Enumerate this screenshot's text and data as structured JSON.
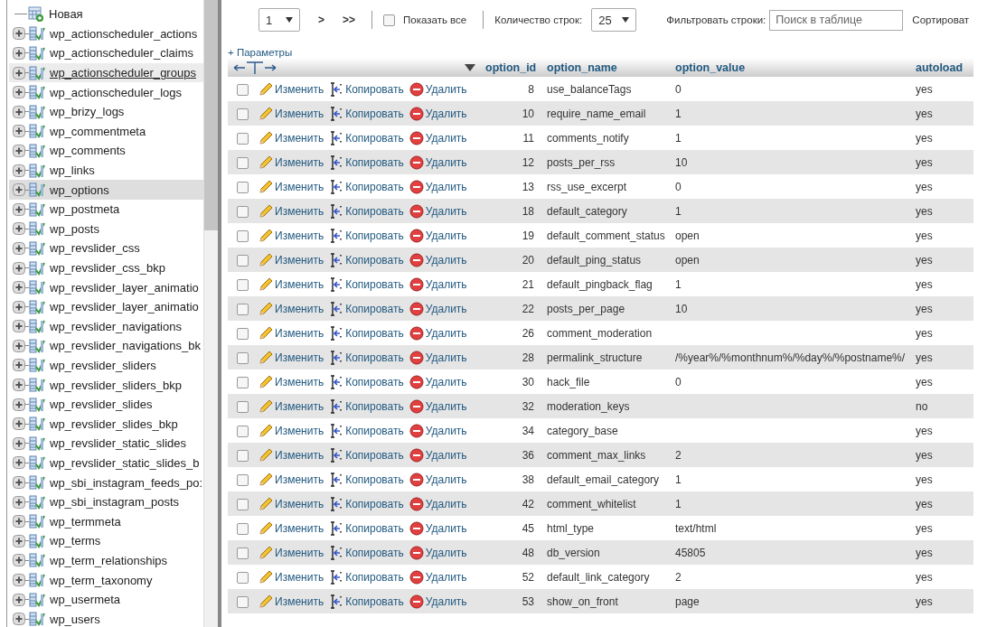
{
  "sidebar": {
    "new_item": "Новая",
    "items": [
      {
        "label": "wp_actionscheduler_actions",
        "selected": false,
        "hovered": false
      },
      {
        "label": "wp_actionscheduler_claims",
        "selected": false,
        "hovered": false
      },
      {
        "label": "wp_actionscheduler_groups",
        "selected": false,
        "hovered": true
      },
      {
        "label": "wp_actionscheduler_logs",
        "selected": false,
        "hovered": false
      },
      {
        "label": "wp_brizy_logs",
        "selected": false,
        "hovered": false
      },
      {
        "label": "wp_commentmeta",
        "selected": false,
        "hovered": false
      },
      {
        "label": "wp_comments",
        "selected": false,
        "hovered": false
      },
      {
        "label": "wp_links",
        "selected": false,
        "hovered": false
      },
      {
        "label": "wp_options",
        "selected": true,
        "hovered": false
      },
      {
        "label": "wp_postmeta",
        "selected": false,
        "hovered": false
      },
      {
        "label": "wp_posts",
        "selected": false,
        "hovered": false
      },
      {
        "label": "wp_revslider_css",
        "selected": false,
        "hovered": false
      },
      {
        "label": "wp_revslider_css_bkp",
        "selected": false,
        "hovered": false
      },
      {
        "label": "wp_revslider_layer_animatio",
        "selected": false,
        "hovered": false
      },
      {
        "label": "wp_revslider_layer_animatio",
        "selected": false,
        "hovered": false
      },
      {
        "label": "wp_revslider_navigations",
        "selected": false,
        "hovered": false
      },
      {
        "label": "wp_revslider_navigations_bk",
        "selected": false,
        "hovered": false
      },
      {
        "label": "wp_revslider_sliders",
        "selected": false,
        "hovered": false
      },
      {
        "label": "wp_revslider_sliders_bkp",
        "selected": false,
        "hovered": false
      },
      {
        "label": "wp_revslider_slides",
        "selected": false,
        "hovered": false
      },
      {
        "label": "wp_revslider_slides_bkp",
        "selected": false,
        "hovered": false
      },
      {
        "label": "wp_revslider_static_slides",
        "selected": false,
        "hovered": false
      },
      {
        "label": "wp_revslider_static_slides_b",
        "selected": false,
        "hovered": false
      },
      {
        "label": "wp_sbi_instagram_feeds_po:",
        "selected": false,
        "hovered": false
      },
      {
        "label": "wp_sbi_instagram_posts",
        "selected": false,
        "hovered": false
      },
      {
        "label": "wp_termmeta",
        "selected": false,
        "hovered": false
      },
      {
        "label": "wp_terms",
        "selected": false,
        "hovered": false
      },
      {
        "label": "wp_term_relationships",
        "selected": false,
        "hovered": false
      },
      {
        "label": "wp_term_taxonomy",
        "selected": false,
        "hovered": false
      },
      {
        "label": "wp_usermeta",
        "selected": false,
        "hovered": false
      },
      {
        "label": "wp_users",
        "selected": false,
        "hovered": false
      }
    ]
  },
  "toolbar": {
    "page": "1",
    "next": ">",
    "last": ">>",
    "show_all": {
      "label": "Показать все",
      "checked": false
    },
    "rows_label": "Количество строк:",
    "rows_count": "25",
    "filter_label": "Фильтровать строки:",
    "filter_placeholder": "Поиск в таблице",
    "sort_label": "Сортироват"
  },
  "options_link": "+ Параметры",
  "table": {
    "columns": [
      "option_id",
      "option_name",
      "option_value",
      "autoload"
    ],
    "rows": [
      {
        "checked": false,
        "edit": "Изменить",
        "copy": "Копировать",
        "delete": "Удалить",
        "option_id": "8",
        "option_name": "use_balanceTags",
        "option_value": "0",
        "autoload": "yes"
      },
      {
        "checked": false,
        "edit": "Изменить",
        "copy": "Копировать",
        "delete": "Удалить",
        "option_id": "10",
        "option_name": "require_name_email",
        "option_value": "1",
        "autoload": "yes"
      },
      {
        "checked": false,
        "edit": "Изменить",
        "copy": "Копировать",
        "delete": "Удалить",
        "option_id": "11",
        "option_name": "comments_notify",
        "option_value": "1",
        "autoload": "yes"
      },
      {
        "checked": false,
        "edit": "Изменить",
        "copy": "Копировать",
        "delete": "Удалить",
        "option_id": "12",
        "option_name": "posts_per_rss",
        "option_value": "10",
        "autoload": "yes"
      },
      {
        "checked": false,
        "edit": "Изменить",
        "copy": "Копировать",
        "delete": "Удалить",
        "option_id": "13",
        "option_name": "rss_use_excerpt",
        "option_value": "0",
        "autoload": "yes"
      },
      {
        "checked": false,
        "edit": "Изменить",
        "copy": "Копировать",
        "delete": "Удалить",
        "option_id": "18",
        "option_name": "default_category",
        "option_value": "1",
        "autoload": "yes"
      },
      {
        "checked": false,
        "edit": "Изменить",
        "copy": "Копировать",
        "delete": "Удалить",
        "option_id": "19",
        "option_name": "default_comment_status",
        "option_value": "open",
        "autoload": "yes"
      },
      {
        "checked": false,
        "edit": "Изменить",
        "copy": "Копировать",
        "delete": "Удалить",
        "option_id": "20",
        "option_name": "default_ping_status",
        "option_value": "open",
        "autoload": "yes"
      },
      {
        "checked": false,
        "edit": "Изменить",
        "copy": "Копировать",
        "delete": "Удалить",
        "option_id": "21",
        "option_name": "default_pingback_flag",
        "option_value": "1",
        "autoload": "yes"
      },
      {
        "checked": false,
        "edit": "Изменить",
        "copy": "Копировать",
        "delete": "Удалить",
        "option_id": "22",
        "option_name": "posts_per_page",
        "option_value": "10",
        "autoload": "yes"
      },
      {
        "checked": false,
        "edit": "Изменить",
        "copy": "Копировать",
        "delete": "Удалить",
        "option_id": "26",
        "option_name": "comment_moderation",
        "autoload": "yes"
      },
      {
        "checked": false,
        "edit": "Изменить",
        "copy": "Копировать",
        "delete": "Удалить",
        "option_id": "28",
        "option_name": "permalink_structure",
        "option_value": "/%year%/%monthnum%/%day%/%postname%/",
        "autoload": "yes"
      },
      {
        "checked": false,
        "edit": "Изменить",
        "copy": "Копировать",
        "delete": "Удалить",
        "option_id": "30",
        "option_name": "hack_file",
        "option_value": "0",
        "autoload": "yes"
      },
      {
        "checked": false,
        "edit": "Изменить",
        "copy": "Копировать",
        "delete": "Удалить",
        "option_id": "32",
        "option_name": "moderation_keys",
        "autoload": "no"
      },
      {
        "checked": false,
        "edit": "Изменить",
        "copy": "Копировать",
        "delete": "Удалить",
        "option_id": "34",
        "option_name": "category_base",
        "autoload": "yes"
      },
      {
        "checked": false,
        "edit": "Изменить",
        "copy": "Копировать",
        "delete": "Удалить",
        "option_id": "36",
        "option_name": "comment_max_links",
        "option_value": "2",
        "autoload": "yes"
      },
      {
        "checked": false,
        "edit": "Изменить",
        "copy": "Копировать",
        "delete": "Удалить",
        "option_id": "38",
        "option_name": "default_email_category",
        "option_value": "1",
        "autoload": "yes"
      },
      {
        "checked": false,
        "edit": "Изменить",
        "copy": "Копировать",
        "delete": "Удалить",
        "option_id": "42",
        "option_name": "comment_whitelist",
        "option_value": "1",
        "autoload": "yes"
      },
      {
        "checked": false,
        "edit": "Изменить",
        "copy": "Копировать",
        "delete": "Удалить",
        "option_id": "45",
        "option_name": "html_type",
        "option_value": "text/html",
        "autoload": "yes"
      },
      {
        "checked": false,
        "edit": "Изменить",
        "copy": "Копировать",
        "delete": "Удалить",
        "option_id": "48",
        "option_name": "db_version",
        "option_value": "45805",
        "autoload": "yes"
      },
      {
        "checked": false,
        "edit": "Изменить",
        "copy": "Копировать",
        "delete": "Удалить",
        "option_id": "52",
        "option_name": "default_link_category",
        "option_value": "2",
        "autoload": "yes"
      },
      {
        "checked": false,
        "edit": "Изменить",
        "copy": "Копировать",
        "delete": "Удалить",
        "option_id": "53",
        "option_name": "show_on_front",
        "option_value": "page",
        "autoload": "yes"
      }
    ]
  }
}
